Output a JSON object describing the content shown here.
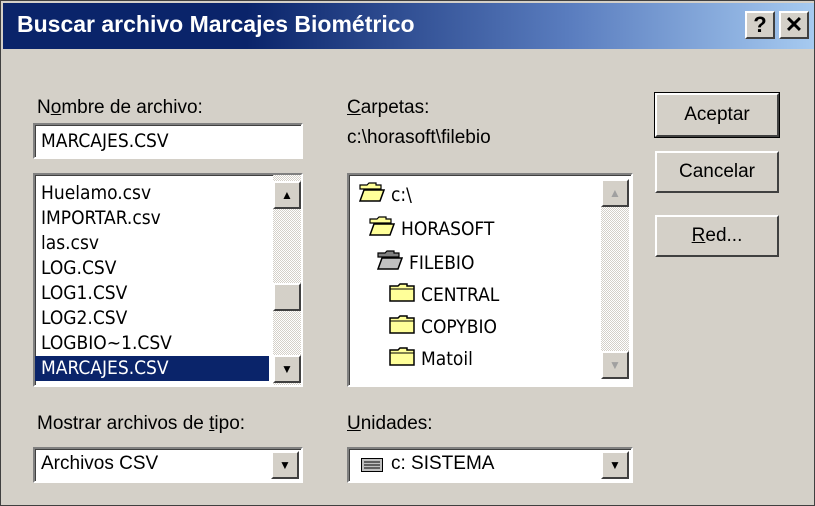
{
  "window": {
    "title": "Buscar archivo Marcajes Biométrico",
    "help_label": "?",
    "close_label": "✕"
  },
  "file_name": {
    "label_prefix": "N",
    "label_accel": "o",
    "label_rest": "mbre de archivo:",
    "value": "MARCAJES.CSV"
  },
  "file_list": {
    "items": [
      "Huelamo.csv",
      "IMPORTAR.csv",
      "las.csv",
      "LOG.CSV",
      "LOG1.CSV",
      "LOG2.CSV",
      "LOGBIO~1.CSV",
      "MARCAJES.CSV"
    ],
    "selected_index": 7
  },
  "folders": {
    "label_accel": "C",
    "label_rest": "arpetas:",
    "current_path": "c:\\horasoft\\filebio",
    "tree": [
      {
        "label": "c:\\",
        "state": "open"
      },
      {
        "label": "HORASOFT",
        "state": "open"
      },
      {
        "label": "FILEBIO",
        "state": "open-current"
      },
      {
        "label": "CENTRAL",
        "state": "closed"
      },
      {
        "label": "COPYBIO",
        "state": "closed"
      },
      {
        "label": "Matoil",
        "state": "closed"
      }
    ]
  },
  "buttons": {
    "accept": "Aceptar",
    "cancel": "Cancelar",
    "network_accel": "R",
    "network_rest": "ed..."
  },
  "file_type": {
    "label_prefix": "Mostrar archivos de ",
    "label_accel": "t",
    "label_rest": "ipo:",
    "value": "Archivos CSV"
  },
  "drives": {
    "label_accel": "U",
    "label_rest": "nidades:",
    "value": "c: SISTEMA"
  },
  "icons": {
    "scroll_up": "▲",
    "scroll_down": "▼",
    "dropdown": "▼"
  }
}
